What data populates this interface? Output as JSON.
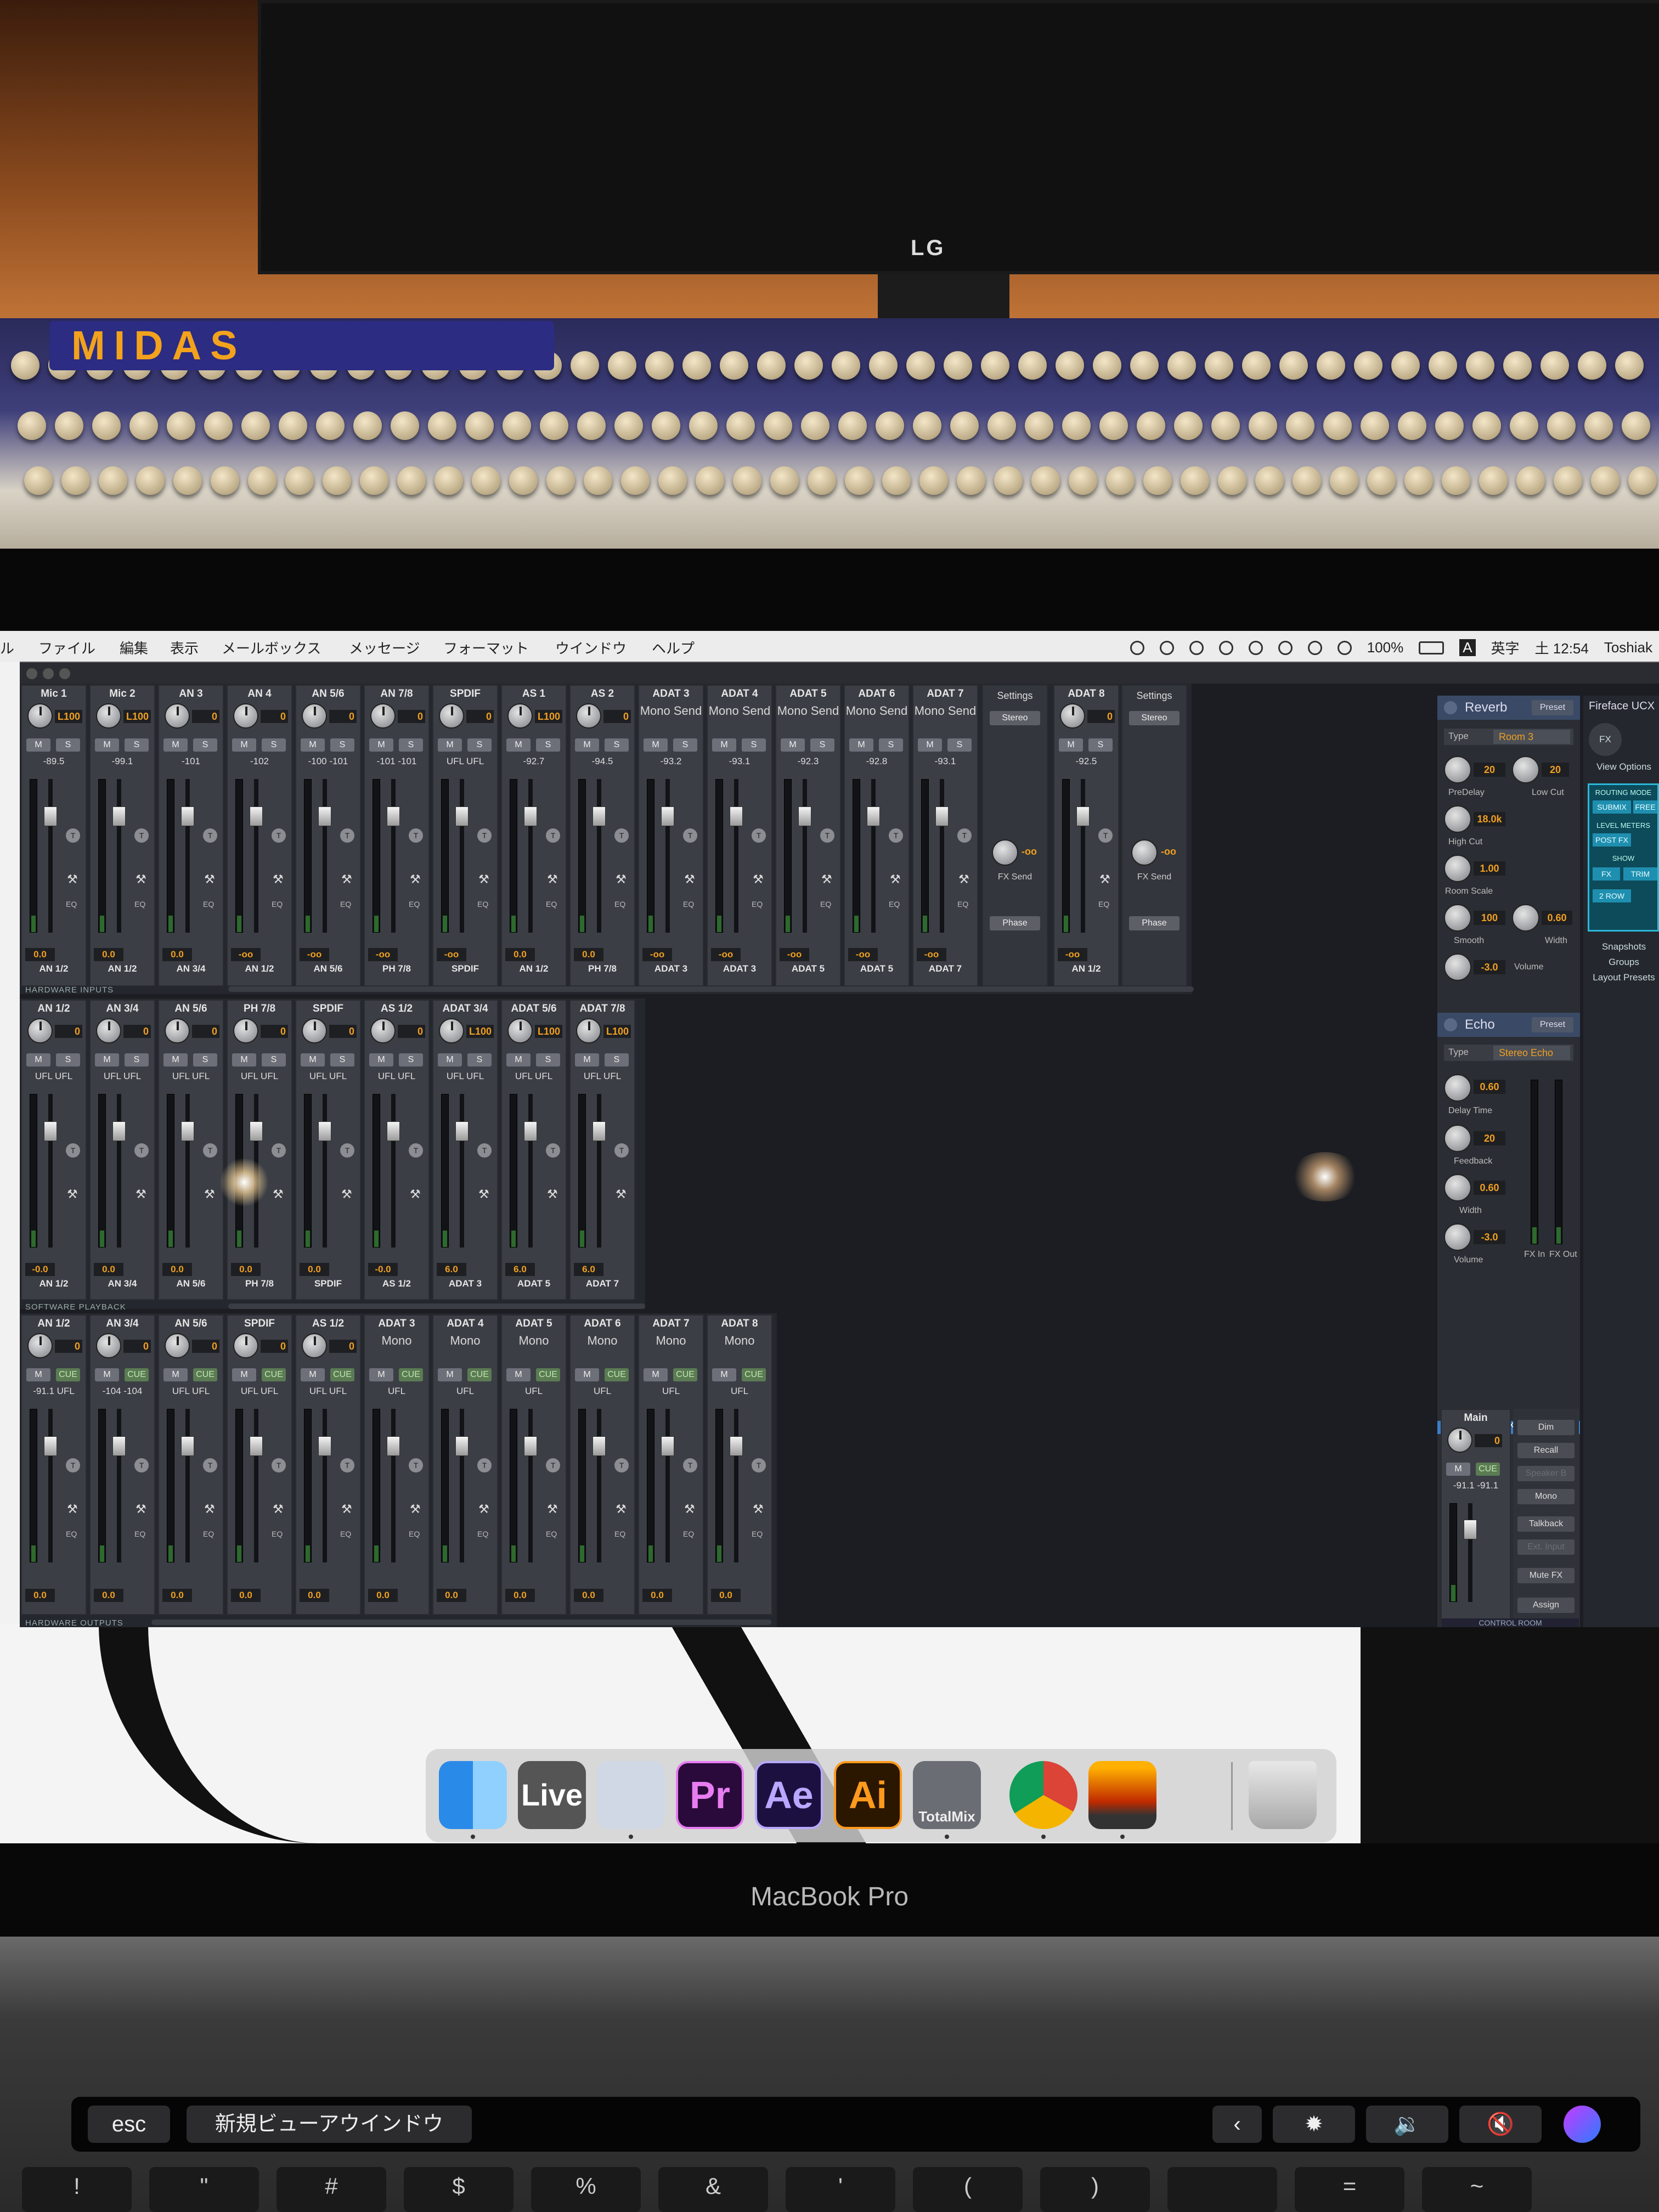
{
  "scene": {
    "monitor_brand": "LG",
    "mixer_brand": "MIDAS",
    "laptop_label": "MacBook Pro"
  },
  "menu_bar": {
    "left_fragment": "ル",
    "items": [
      "ファイル",
      "編集",
      "表示",
      "メールボックス",
      "メッセージ",
      "フォーマット",
      "ウインドウ",
      "ヘルプ"
    ],
    "battery": "100%",
    "input": "英字",
    "input_badge": "A",
    "clock": "土 12:54",
    "user": "Toshiak"
  },
  "rows": {
    "hardware_inputs_label": "HARDWARE INPUTS",
    "software_playback_label": "SOFTWARE PLAYBACK",
    "hardware_outputs_label": "HARDWARE OUTPUTS"
  },
  "buttons": {
    "mute": "M",
    "solo": "S",
    "cue": "CUE",
    "eq": "EQ",
    "talk": "T",
    "d": "D"
  },
  "row1": [
    {
      "name": "Mic 1",
      "gain": "L100",
      "level": "-89.5",
      "value": "0.0",
      "route": "AN 1/2"
    },
    {
      "name": "Mic 2",
      "gain": "L100",
      "level": "-99.1",
      "value": "0.0",
      "route": "AN 1/2"
    },
    {
      "name": "AN 3",
      "gain": "0",
      "level": "-101",
      "value": "0.0",
      "route": "AN 3/4"
    },
    {
      "name": "AN 4",
      "gain": "0",
      "level": "-102",
      "value": "-oo",
      "route": "AN 1/2"
    },
    {
      "name": "AN 5/6",
      "gain": "0",
      "level": "-100 -101",
      "value": "-oo",
      "route": "AN 5/6"
    },
    {
      "name": "AN 7/8",
      "gain": "0",
      "level": "-101 -101",
      "value": "-oo",
      "route": "PH 7/8"
    },
    {
      "name": "SPDIF",
      "gain": "0",
      "level": "UFL UFL",
      "value": "-oo",
      "route": "SPDIF"
    },
    {
      "name": "AS 1",
      "gain": "L100",
      "level": "-92.7",
      "value": "0.0",
      "route": "AN 1/2"
    },
    {
      "name": "AS 2",
      "gain": "0",
      "level": "-94.5",
      "value": "0.0",
      "route": "PH 7/8"
    },
    {
      "name": "ADAT 3",
      "mono": "Mono Send",
      "level": "-93.2",
      "value": "-oo",
      "route": "ADAT 3"
    },
    {
      "name": "ADAT 4",
      "mono": "Mono Send",
      "level": "-93.1",
      "value": "-oo",
      "route": "ADAT 3"
    },
    {
      "name": "ADAT 5",
      "mono": "Mono Send",
      "level": "-92.3",
      "value": "-oo",
      "route": "ADAT 5"
    },
    {
      "name": "ADAT 6",
      "mono": "Mono Send",
      "level": "-92.8",
      "value": "-oo",
      "route": "ADAT 5"
    },
    {
      "name": "ADAT 7",
      "mono": "Mono Send",
      "level": "-93.1",
      "value": "-oo",
      "route": "ADAT 7"
    },
    {
      "name": "ADAT 8",
      "gain": "0",
      "level": "-92.5",
      "value": "-oo",
      "route": "AN 1/2"
    }
  ],
  "settings": {
    "title": "Settings",
    "stereo": "Stereo",
    "fx_value": "-oo",
    "fx_send": "FX Send",
    "phase": "Phase"
  },
  "row2": [
    {
      "name": "AN 1/2",
      "gain": "0",
      "level": "UFL UFL",
      "value": "-0.0",
      "route": "AN 1/2"
    },
    {
      "name": "AN 3/4",
      "gain": "0",
      "level": "UFL UFL",
      "value": "0.0",
      "route": "AN 3/4"
    },
    {
      "name": "AN 5/6",
      "gain": "0",
      "level": "UFL UFL",
      "value": "0.0",
      "route": "AN 5/6"
    },
    {
      "name": "PH 7/8",
      "gain": "0",
      "level": "UFL UFL",
      "value": "0.0",
      "route": "PH 7/8"
    },
    {
      "name": "SPDIF",
      "gain": "0",
      "level": "UFL UFL",
      "value": "0.0",
      "route": "SPDIF"
    },
    {
      "name": "AS 1/2",
      "gain": "0",
      "level": "UFL UFL",
      "value": "-0.0",
      "route": "AS 1/2"
    },
    {
      "name": "ADAT 3/4",
      "gain": "L100",
      "level": "UFL UFL",
      "value": "6.0",
      "route": "ADAT 3"
    },
    {
      "name": "ADAT 5/6",
      "gain": "L100",
      "level": "UFL UFL",
      "value": "6.0",
      "route": "ADAT 5"
    },
    {
      "name": "ADAT 7/8",
      "gain": "L100",
      "level": "UFL UFL",
      "value": "6.0",
      "route": "ADAT 7"
    }
  ],
  "row3": [
    {
      "name": "AN 1/2",
      "gain": "0",
      "level": "-91.1 UFL",
      "value": "0.0"
    },
    {
      "name": "AN 3/4",
      "gain": "0",
      "level": "-104 -104",
      "value": "0.0"
    },
    {
      "name": "AN 5/6",
      "gain": "0",
      "level": "UFL UFL",
      "value": "0.0"
    },
    {
      "name": "SPDIF",
      "gain": "0",
      "level": "UFL UFL",
      "value": "0.0"
    },
    {
      "name": "AS 1/2",
      "gain": "0",
      "level": "UFL UFL",
      "value": "0.0"
    },
    {
      "name": "ADAT 3",
      "mono": "Mono",
      "level": "UFL",
      "value": "0.0"
    },
    {
      "name": "ADAT 4",
      "mono": "Mono",
      "level": "UFL",
      "value": "0.0"
    },
    {
      "name": "ADAT 5",
      "mono": "Mono",
      "level": "UFL",
      "value": "0.0"
    },
    {
      "name": "ADAT 6",
      "mono": "Mono",
      "level": "UFL",
      "value": "0.0"
    },
    {
      "name": "ADAT 7",
      "mono": "Mono",
      "level": "UFL",
      "value": "0.0"
    },
    {
      "name": "ADAT 8",
      "mono": "Mono",
      "level": "UFL",
      "value": "0.0"
    }
  ],
  "reverb": {
    "title": "Reverb",
    "preset": "Preset",
    "type_label": "Type",
    "type": "Room 3",
    "predelay": "20",
    "predelay_label": "PreDelay",
    "lowcut": "20",
    "lowcut_label": "Low Cut",
    "highcut": "18.0k",
    "highcut_label": "High Cut",
    "roomscale": "1.00",
    "roomscale_label": "Room Scale",
    "smooth": "100",
    "smooth_label": "Smooth",
    "width": "0.60",
    "width_label": "Width",
    "volume": "-3.0",
    "volume_label": "Volume"
  },
  "echo": {
    "title": "Echo",
    "preset": "Preset",
    "type_label": "Type",
    "type": "Stereo Echo",
    "delay": "0.60",
    "delay_label": "Delay Time",
    "feedback": "20",
    "feedback_label": "Feedback",
    "width": "0.60",
    "width_label": "Width",
    "volume": "-3.0",
    "volume_label": "Volume",
    "fx_in": "FX In",
    "fx_out": "FX Out"
  },
  "fx_bar": "FX",
  "main": {
    "title": "Main",
    "gain": "0",
    "level": "-91.1 -91.1",
    "value": "0.0",
    "cue": "CUE",
    "mute": "M"
  },
  "control_room": {
    "buttons": [
      "Dim",
      "Recall",
      "Speaker B",
      "Mono",
      "Talkback",
      "Ext. Input",
      "Mute FX",
      "Assign"
    ],
    "label": "CONTROL ROOM"
  },
  "mini_panel": {
    "title": "Fireface UCX",
    "fx": "FX",
    "view_options": "View Options",
    "routing_mode": "ROUTING MODE",
    "submix": "SUBMIX",
    "free": "FREE",
    "level_meters": "LEVEL METERS",
    "post_fx": "POST FX",
    "show": "SHOW",
    "fx_btn": "FX",
    "trim": "TRIM",
    "row2": "2 ROW",
    "snapshots": "Snapshots",
    "groups": "Groups",
    "layout_presets": "Layout Presets"
  },
  "dock": [
    {
      "name": "Finder",
      "label": ""
    },
    {
      "name": "Live",
      "label": "Live"
    },
    {
      "name": "Preview",
      "label": ""
    },
    {
      "name": "Premiere Pro",
      "label": "Pr"
    },
    {
      "name": "After Effects",
      "label": "Ae"
    },
    {
      "name": "Illustrator",
      "label": "Ai"
    },
    {
      "name": "TotalMix",
      "label": "TotalMix"
    },
    {
      "name": "Chrome",
      "label": ""
    },
    {
      "name": "RME",
      "label": ""
    },
    {
      "name": "Trash",
      "label": ""
    }
  ],
  "touch_bar": {
    "esc": "esc",
    "new_view": "新規ビューアウインドウ"
  },
  "keys": [
    "!",
    "\"",
    "#",
    "$",
    "%",
    "&",
    "'",
    "(",
    ")",
    "",
    "=",
    "~"
  ],
  "colors": {
    "accent_orange": "#f0a020",
    "fx_blue": "#3d7bc8",
    "routing_cyan": "#2bb8d8",
    "cue_green": "#5b7b53"
  }
}
